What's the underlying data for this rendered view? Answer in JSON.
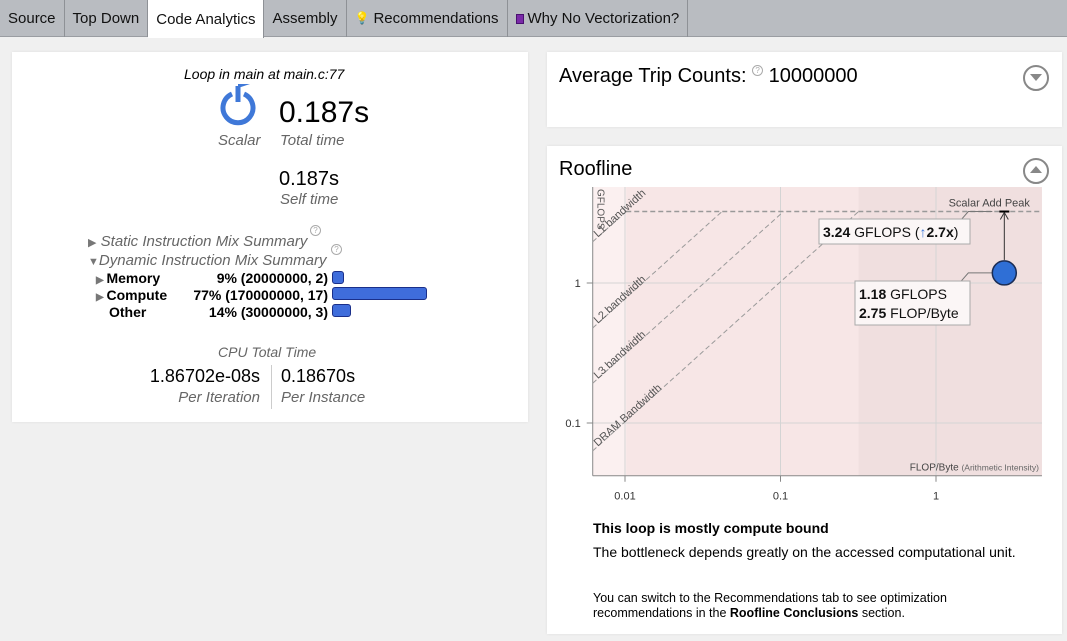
{
  "tabs": [
    {
      "label": "Source"
    },
    {
      "label": "Top Down"
    },
    {
      "label": "Code Analytics",
      "active": true
    },
    {
      "label": "Assembly"
    },
    {
      "label": "Recommendations",
      "icon": "lightbulb-icon"
    },
    {
      "label": "Why No Vectorization?",
      "icon": "book-icon"
    }
  ],
  "summary": {
    "loop_title": "Loop in main at main.c:77",
    "mode_label": "Scalar",
    "total_time": "0.187s",
    "total_time_label": "Total time",
    "self_time": "0.187s",
    "self_time_label": "Self time",
    "static_mix": "Static Instruction Mix Summary",
    "dynamic_mix": "Dynamic Instruction Mix Summary",
    "mix": [
      {
        "name": "Memory",
        "value": "9% (20000000, 2)",
        "percent": 9
      },
      {
        "name": "Compute",
        "value": "77% (170000000, 17)",
        "percent": 77
      },
      {
        "name": "Other",
        "value": "14% (30000000, 3)",
        "percent": 14
      }
    ],
    "cpu_total_time": "CPU Total Time",
    "per_iteration": "1.86702e-08s",
    "per_iteration_label": "Per Iteration",
    "per_instance": "0.18670s",
    "per_instance_label": "Per Instance"
  },
  "trip": {
    "label": "Average Trip Counts:",
    "value": "10000000"
  },
  "roofline": {
    "title": "Roofline",
    "conclusion_title": "This loop is mostly compute bound",
    "conclusion_text": "The bottleneck depends greatly on the accessed computational unit.",
    "recommend_pre": "You can switch to the Recommendations tab to see optimization recommendations in the ",
    "recommend_bold": "Roofline Conclusions",
    "recommend_post": " section."
  },
  "chart_data": {
    "type": "scatter",
    "xscale": "log",
    "yscale": "log",
    "xlabel": "FLOP/Byte",
    "xlabel_note": "(Arithmetic Intensity)",
    "ylabel": "GFLOPS",
    "xlim": [
      0.0062,
      4.8
    ],
    "ylim": [
      0.042,
      4.85
    ],
    "x_ticks": [
      "0.01",
      "0.1",
      "1"
    ],
    "y_ticks": [
      "1",
      "0.1"
    ],
    "roofs": [
      {
        "name": "Scalar Add Peak",
        "gflops": 3.24
      }
    ],
    "bandwidths": [
      {
        "name": "L1 bandwidth",
        "gbps": 318
      },
      {
        "name": "L2 bandwidth",
        "gbps": 77
      },
      {
        "name": "L3 bandwidth",
        "gbps": 31
      },
      {
        "name": "DRAM Bandwidth",
        "gbps": 10.2
      }
    ],
    "points": [
      {
        "ai": 2.75,
        "gflops": 1.18,
        "color": "#2f6fd6"
      }
    ],
    "point_label": {
      "gflops": "1.18",
      "gflops_unit": "GFLOPS",
      "ai": "2.75",
      "ai_unit": "FLOP/Byte"
    },
    "peak_label": {
      "gflops": "3.24",
      "unit": "GFLOPS (",
      "arrow": "↑",
      "speedup": "2.7x",
      "close": ")"
    }
  }
}
